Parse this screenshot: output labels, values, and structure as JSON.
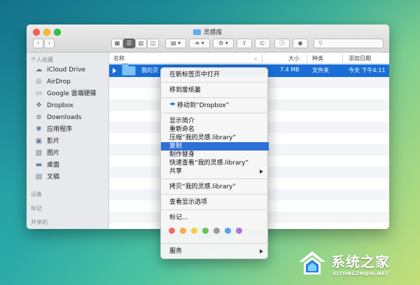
{
  "window": {
    "title": "灵感库",
    "search_placeholder": ""
  },
  "toolbar": {
    "back_icon": "chevron-left-icon",
    "forward_icon": "chevron-right-icon",
    "view_icons": [
      "icon-view-icon",
      "list-view-icon",
      "column-view-icon",
      "cover-flow-icon"
    ],
    "arrange_icon": "grid-arrange-icon",
    "sort_icon": "sort-lines-icon",
    "action_icon": "gear-icon",
    "share_icon": "share-icon",
    "tag_icon": "folder-tag-icon",
    "info_icon": "info-icon",
    "preview_icon": "eye-icon"
  },
  "sidebar": {
    "favorites_header": "个人收藏",
    "items": [
      {
        "label": "iCloud Drive",
        "icon": "cloud-icon"
      },
      {
        "label": "AirDrop",
        "icon": "airdrop-icon"
      },
      {
        "label": "Google 雲端硬碟",
        "icon": "folder-icon"
      },
      {
        "label": "Dropbox",
        "icon": "dropbox-icon"
      },
      {
        "label": "Downloads",
        "icon": "download-icon"
      },
      {
        "label": "应用程序",
        "icon": "applications-icon"
      },
      {
        "label": "影片",
        "icon": "movies-icon"
      },
      {
        "label": "图片",
        "icon": "pictures-icon"
      },
      {
        "label": "桌面",
        "icon": "desktop-icon"
      },
      {
        "label": "文稿",
        "icon": "documents-icon"
      }
    ],
    "devices_header": "设备",
    "tags_header": "标记",
    "shared_header": "共享的"
  },
  "columns": {
    "name": "名称",
    "size": "大小",
    "kind": "种类",
    "date": "添加日期"
  },
  "selected_row": {
    "name": "我的灵",
    "size": "7.4 MB",
    "kind": "文件夹",
    "date": "今天 下午4:11"
  },
  "context_menu": {
    "items": [
      {
        "label": "在新标签页中打开"
      },
      {
        "label": "移到废纸篓"
      },
      {
        "label": "移动到“Dropbox”"
      },
      {
        "label": "显示简介"
      },
      {
        "label": "重新命名"
      },
      {
        "label": "压缩“我的灵感.library”"
      },
      {
        "label": "复制"
      },
      {
        "label": "制作替身"
      },
      {
        "label": "快速查看“我的灵感.library”"
      },
      {
        "label": "共享"
      },
      {
        "label": "拷贝“我的灵感.library”"
      },
      {
        "label": "查看显示选项"
      },
      {
        "label": "标记..."
      },
      {
        "label": "服务"
      }
    ],
    "highlighted_index": 6,
    "tag_colors": [
      "#f26b5f",
      "#f5a948",
      "#f2cf46",
      "#60c655",
      "#5aa4f0",
      "#a57ad8",
      "#9a9a9a"
    ]
  },
  "watermark": {
    "title": "系统之家",
    "subtitle": "XITONGZHIJIA.NET"
  }
}
